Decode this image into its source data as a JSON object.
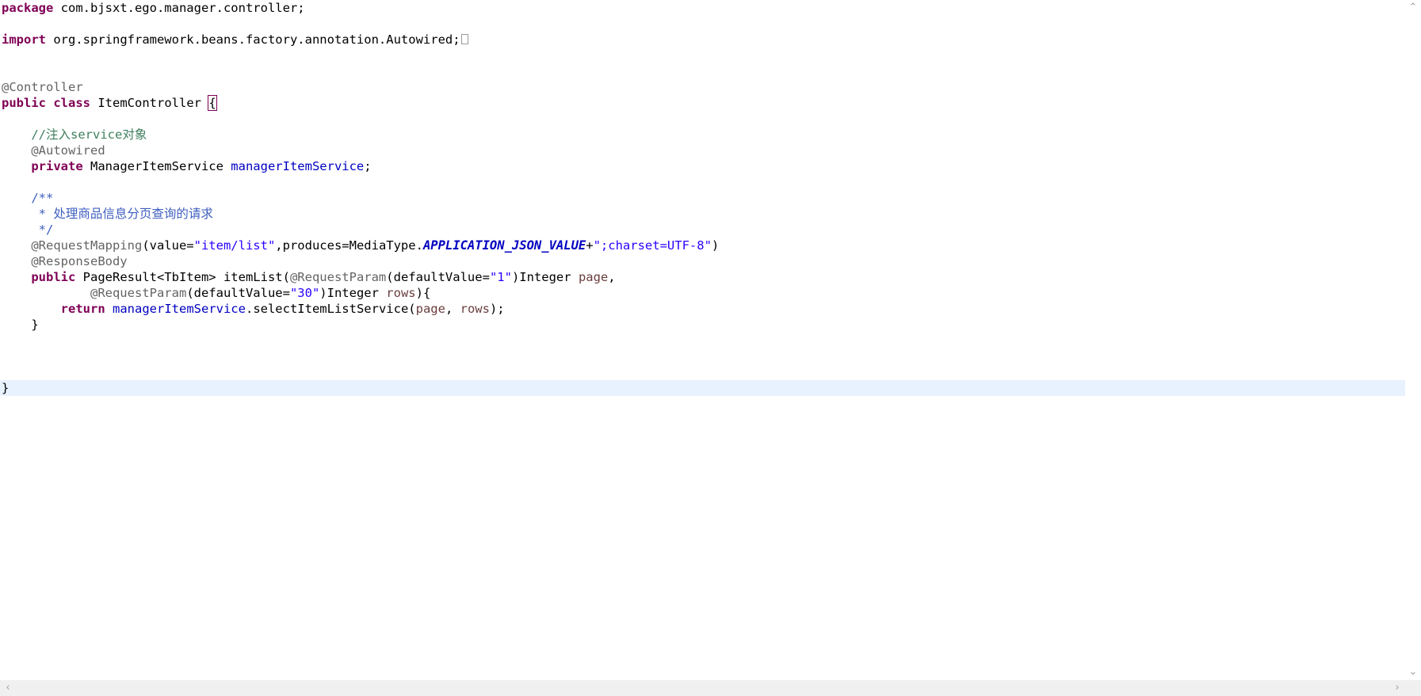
{
  "editor": {
    "lines": {
      "l1": {
        "kw": "package",
        "text": " com.bjsxt.ego.manager.controller;"
      },
      "l3": {
        "kw": "import",
        "text": " org.springframework.beans.factory.annotation.Autowired;"
      },
      "l6": {
        "ann": "@Controller"
      },
      "l7": {
        "kw1": "public",
        "kw2": "class",
        "text": " ItemController ",
        "brace": "{"
      },
      "l9": {
        "indent": "    ",
        "cmt": "//注入service对象"
      },
      "l10": {
        "indent": "    ",
        "ann": "@Autowired"
      },
      "l11": {
        "indent": "    ",
        "kw": "private",
        "text": " ManagerItemService ",
        "fld": "managerItemService",
        "tail": ";"
      },
      "l13": {
        "indent": "    ",
        "doc": "/**"
      },
      "l14": {
        "indent": "     ",
        "doc": "* 处理商品信息分页查询的请求"
      },
      "l15": {
        "indent": "     ",
        "doc": "*/"
      },
      "l16": {
        "indent": "    ",
        "ann": "@RequestMapping",
        "t1": "(value=",
        "s1": "\"item/list\"",
        "t2": ",produces=MediaType.",
        "const": "APPLICATION_JSON_VALUE",
        "t3": "+",
        "s2": "\";charset=UTF-8\"",
        "t4": ")"
      },
      "l17": {
        "indent": "    ",
        "ann": "@ResponseBody"
      },
      "l18": {
        "indent": "    ",
        "kw": "public",
        "t1": " PageResult<TbItem> itemList(",
        "ann": "@RequestParam",
        "t2": "(defaultValue=",
        "s1": "\"1\"",
        "t3": ")Integer ",
        "param": "page",
        "t4": ","
      },
      "l19": {
        "indent": "            ",
        "ann": "@RequestParam",
        "t1": "(defaultValue=",
        "s1": "\"30\"",
        "t2": ")Integer ",
        "param": "rows",
        "t3": "){"
      },
      "l20": {
        "indent": "        ",
        "kw": "return",
        "t1": " ",
        "fld": "managerItemService",
        "t2": ".selectItemListService(",
        "p1": "page",
        "t3": ", ",
        "p2": "rows",
        "t4": ");"
      },
      "l21": {
        "text": "    }"
      },
      "l25": {
        "text": "}"
      }
    }
  },
  "scrollbars": {
    "up_arrow": "⌃",
    "down_arrow": "⌄",
    "left_arrow": "‹",
    "right_arrow": "›"
  }
}
